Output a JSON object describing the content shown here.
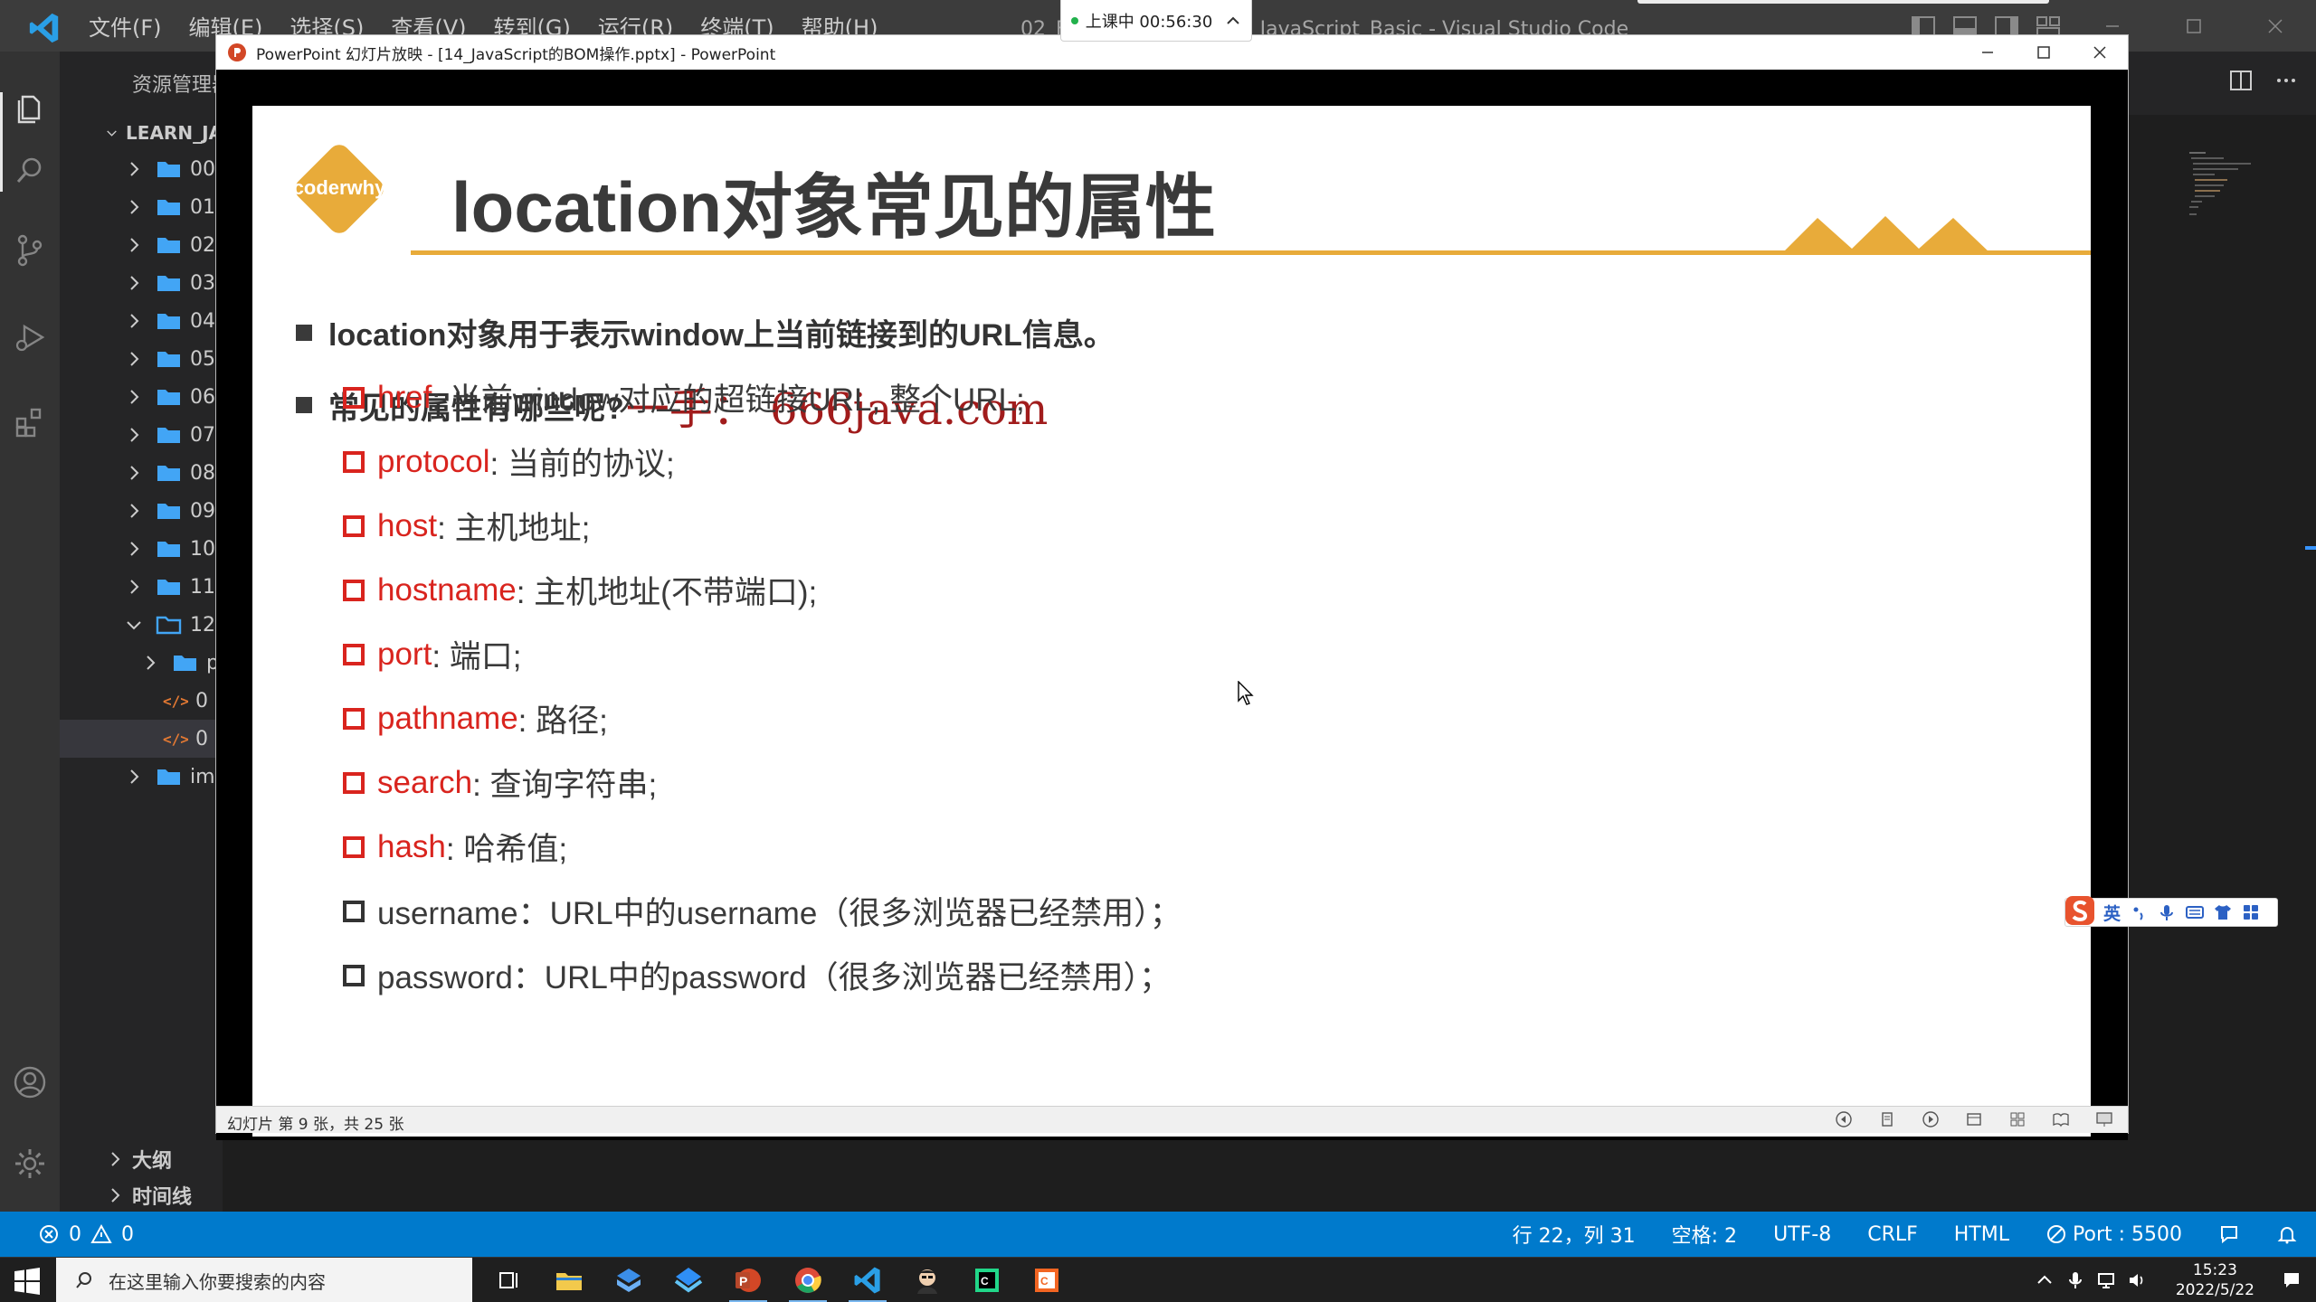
{
  "vscode": {
    "menu": [
      "文件(F)",
      "编辑(E)",
      "选择(S)",
      "查看(V)",
      "转到(G)",
      "运行(R)",
      "终端(T)",
      "帮助(H)"
    ],
    "window_title": "02_F...使用.html - Learn_JavaScript_Basic - Visual Studio Code",
    "explorer_title": "资源管理器",
    "workspace": "LEARN_JA",
    "tree_items": [
      "00",
      "01",
      "02",
      "03",
      "04",
      "05",
      "06",
      "07",
      "08",
      "09",
      "10",
      "11",
      "12",
      "p",
      "0",
      "0",
      "im"
    ],
    "outline_label": "大纲",
    "timeline_label": "时间线"
  },
  "class_timer": {
    "text": "上课中 00:56:30"
  },
  "powerpoint": {
    "title": "PowerPoint 幻灯片放映 - [14_JavaScript的BOM操作.pptx] - PowerPoint",
    "status_text": "幻灯片 第 9 张，共 25 张"
  },
  "slide": {
    "logo_text": "coderwhy",
    "title": "location对象常见的属性",
    "bullet1": "location对象用于表示window上当前链接到的URL信息。",
    "bullet2": "常见的属性有哪些呢?",
    "watermark": "一手： 666java.com",
    "props": [
      {
        "name": "href",
        "desc": ": 当前window对应的超链接URL, 整个URL;"
      },
      {
        "name": "protocol",
        "desc": ": 当前的协议;"
      },
      {
        "name": "host",
        "desc": ": 主机地址;"
      },
      {
        "name": "hostname",
        "desc": ": 主机地址(不带端口);"
      },
      {
        "name": "port",
        "desc": ": 端口;"
      },
      {
        "name": "pathname",
        "desc": ": 路径;"
      },
      {
        "name": "search",
        "desc": ": 查询字符串;"
      },
      {
        "name": "hash",
        "desc": ": 哈希值;"
      }
    ],
    "plain_props": [
      "username：URL中的username（很多浏览器已经禁用）；",
      "password：URL中的password（很多浏览器已经禁用）；"
    ]
  },
  "statusbar": {
    "errors": "0",
    "warnings": "0",
    "position": "行 22，列 31",
    "spaces": "空格: 2",
    "encoding": "UTF-8",
    "eol": "CRLF",
    "language": "HTML",
    "port": "Port : 5500"
  },
  "ime": {
    "mode": "英"
  },
  "taskbar": {
    "search_placeholder": "在这里输入你要搜索的内容",
    "time": "15:23",
    "date": "2022/5/22"
  },
  "colors": {
    "accent_red": "#d9241e",
    "logo_orange": "#e8ab3a",
    "vscode_blue": "#007acc"
  }
}
